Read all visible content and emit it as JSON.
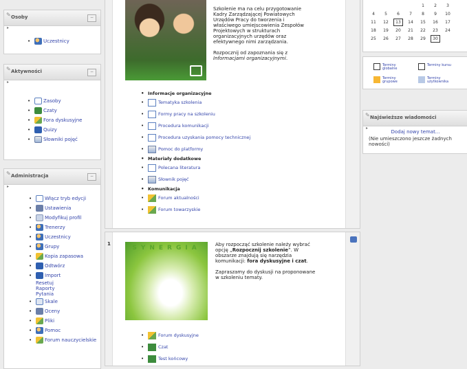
{
  "left": {
    "osoby": {
      "title": "Osoby",
      "items": [
        {
          "label": "Uczestnicy",
          "icon": "users-icon"
        }
      ]
    },
    "aktywnosci": {
      "title": "Aktywności",
      "items": [
        {
          "label": "Zasoby",
          "icon": "resources-icon"
        },
        {
          "label": "Czaty",
          "icon": "chat-icon"
        },
        {
          "label": "Fora dyskusyjne",
          "icon": "forum-icon"
        },
        {
          "label": "Quizy",
          "icon": "quiz-icon"
        },
        {
          "label": "Słowniki pojęć",
          "icon": "glossary-icon"
        }
      ]
    },
    "administracja": {
      "title": "Administracja",
      "items": [
        {
          "label": "Włącz tryb edycji",
          "icon": "edit-mode-icon"
        },
        {
          "label": "Ustawienia",
          "icon": "settings-icon"
        },
        {
          "label": "Modyfikuj profil",
          "icon": "profile-icon"
        },
        {
          "label": "Trenerzy",
          "icon": "trainers-icon"
        },
        {
          "label": "Uczestnicy",
          "icon": "users-icon"
        },
        {
          "label": "Grupy",
          "icon": "groups-icon"
        },
        {
          "label": "Kopia zapasowa",
          "icon": "backup-icon"
        },
        {
          "label": "Odtwórz",
          "icon": "restore-icon"
        },
        {
          "label": "Import",
          "icon": "import-icon"
        },
        {
          "label": "Resetuj",
          "icon": ""
        },
        {
          "label": "Raporty",
          "icon": ""
        },
        {
          "label": "Pytania",
          "icon": ""
        },
        {
          "label": "Skale",
          "icon": "scales-icon"
        },
        {
          "label": "Oceny",
          "icon": "grades-icon"
        },
        {
          "label": "Pliki",
          "icon": "files-icon"
        },
        {
          "label": "Pomoc",
          "icon": "help-icon"
        },
        {
          "label": "Forum nauczycielskie",
          "icon": "forum-icon"
        }
      ]
    }
  },
  "main": {
    "section0": {
      "intro": "Szkolenie ma na celu przygotowanie Kadry Zarządzającej Powiatowych Urzędów Pracy do tworzenia i właściwego umiejscowienia Zespołów Projektowych w strukturach organizacyjnych urzędów oraz efektywnego nimi zarządzania.",
      "intro2_prefix": "Rozpocznij od zapoznania się z ",
      "intro2_italic": "Informacjami organizacyjnymi",
      "intro2_suffix": ".",
      "list": [
        {
          "kind": "head",
          "label": "Informacje organizacyjne"
        },
        {
          "kind": "link",
          "label": "Tematyka szkolenia",
          "icon": "page-icon"
        },
        {
          "kind": "link",
          "label": "Formy pracy na szkoleniu",
          "icon": "page-icon"
        },
        {
          "kind": "link",
          "label": "Procedura komunikacji",
          "icon": "page-icon"
        },
        {
          "kind": "link",
          "label": "Procedura uzyskania pomocy technicznej",
          "icon": "page-icon"
        },
        {
          "kind": "link",
          "label": "Pomoc do platformy",
          "icon": "help-page-icon"
        },
        {
          "kind": "head",
          "label": "Materiały dodatkowe"
        },
        {
          "kind": "link",
          "label": "Polecana literatura",
          "icon": "page-icon"
        },
        {
          "kind": "link",
          "label": "Słownik pojęć",
          "icon": "glossary-icon"
        },
        {
          "kind": "head",
          "label": "Komunikacja"
        },
        {
          "kind": "link",
          "label": "Forum aktualności",
          "icon": "forum-icon"
        },
        {
          "kind": "link",
          "label": "Forum towarzyskie",
          "icon": "forum-icon"
        }
      ]
    },
    "section1": {
      "number": "1",
      "logo_word": "SYNERGIA",
      "p1_prefix": "Aby rozpocząć szkolenie należy wybrać opcję „",
      "p1_bold": "Rozpocznij szkolenie",
      "p1_mid": "”. W obszarze znajdują się narzędzia komunikacji: ",
      "p1_bold2": "fora dyskusyjne i czat",
      "p1_suffix": ".",
      "p2": "Zapraszamy do dyskusji na proponowane w szkoleniu tematy.",
      "list": [
        {
          "label": "Forum dyskusyjne",
          "icon": "forum-icon"
        },
        {
          "label": "Czat",
          "icon": "chat-icon"
        },
        {
          "label": "Test końcowy",
          "icon": "quiz-icon"
        }
      ]
    }
  },
  "right": {
    "calendar": {
      "rows": [
        [
          "",
          "",
          "",
          "",
          "1",
          "2",
          "3"
        ],
        [
          "4",
          "5",
          "6",
          "7",
          "8",
          "9",
          "10"
        ],
        [
          "11",
          "12",
          "13",
          "14",
          "15",
          "16",
          "17"
        ],
        [
          "18",
          "19",
          "20",
          "21",
          "22",
          "23",
          "24"
        ],
        [
          "25",
          "26",
          "27",
          "28",
          "29",
          "30",
          ""
        ]
      ],
      "boxed": [
        "13",
        "30"
      ]
    },
    "legend": [
      {
        "label": "Terminy globalne",
        "color": "#ffffff"
      },
      {
        "label": "Terminy kursu",
        "color": "#ffffff"
      },
      {
        "label": "Terminy grupowe",
        "color": "#f7b733"
      },
      {
        "label": "Terminy użytkownika",
        "color": "#b8c9e6"
      }
    ],
    "news": {
      "title": "Najświeższe wiadomości",
      "add_link": "Dodaj nowy temat...",
      "none_text": "(Nie umieszczono jeszcze żadnych nowości)"
    }
  },
  "colors": {
    "link": "#3344aa",
    "accent_green": "#5aa52c",
    "panel_border": "#cfcfcf"
  }
}
